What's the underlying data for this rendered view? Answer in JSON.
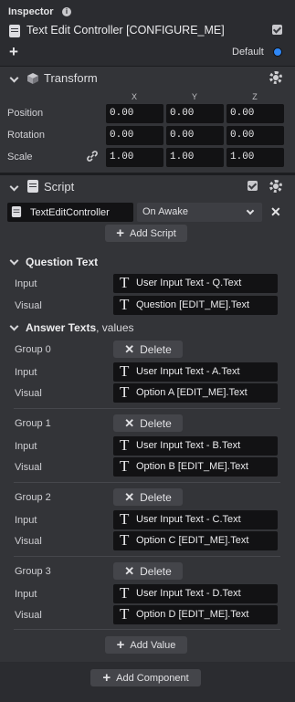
{
  "inspector": {
    "title": "Inspector",
    "info_icon": "info-icon",
    "object_name": "Text Edit Controller [CONFIGURE_ME]",
    "object_enabled": true,
    "layer": "Default",
    "layer_color": "#2f87f6"
  },
  "transform": {
    "title": "Transform",
    "axes": [
      "X",
      "Y",
      "Z"
    ],
    "rows": [
      {
        "label": "Position",
        "values": [
          "0.00",
          "0.00",
          "0.00"
        ]
      },
      {
        "label": "Rotation",
        "values": [
          "0.00",
          "0.00",
          "0.00"
        ]
      },
      {
        "label": "Scale",
        "values": [
          "1.00",
          "1.00",
          "1.00"
        ]
      }
    ]
  },
  "script": {
    "title": "Script",
    "enabled": true,
    "script_name": "TextEditController",
    "event": "On Awake",
    "add_script": "Add Script"
  },
  "question": {
    "title": "Question Text",
    "input_label": "Input",
    "input_value": "User Input Text - Q.Text",
    "visual_label": "Visual",
    "visual_value": "Question [EDIT_ME].Text"
  },
  "answers": {
    "title": "Answer Texts",
    "suffix": ", values",
    "delete_label": "Delete",
    "input_label": "Input",
    "visual_label": "Visual",
    "groups": [
      {
        "label": "Group 0",
        "input": "User Input Text - A.Text",
        "visual": "Option A [EDIT_ME].Text"
      },
      {
        "label": "Group 1",
        "input": "User Input Text - B.Text",
        "visual": "Option B [EDIT_ME].Text"
      },
      {
        "label": "Group 2",
        "input": "User Input Text - C.Text",
        "visual": "Option C [EDIT_ME].Text"
      },
      {
        "label": "Group 3",
        "input": "User Input Text - D.Text",
        "visual": "Option D [EDIT_ME].Text"
      }
    ],
    "add_value": "Add Value"
  },
  "footer": {
    "add_component": "Add Component"
  }
}
